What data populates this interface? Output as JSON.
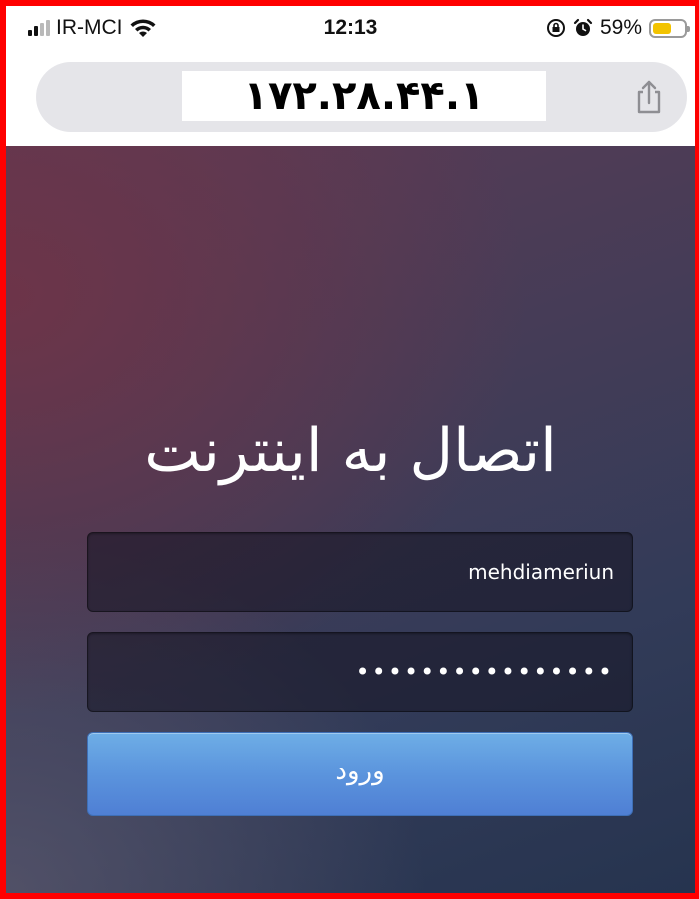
{
  "status_bar": {
    "carrier": "IR-MCI",
    "time": "12:13",
    "battery_percent": "59%",
    "battery_level": 0.59,
    "icons": [
      "signal-icon",
      "wifi-icon",
      "rotation-lock-icon",
      "alarm-icon",
      "battery-icon"
    ]
  },
  "browser": {
    "url": "۱۷۲.۲۸.۴۴.۱",
    "share_icon": "share-icon"
  },
  "login": {
    "title": "اتصال به اینترنت",
    "username_value": "mehdiameriun",
    "password_value": "••••••••••••••••",
    "submit_label": "ورود"
  },
  "colors": {
    "button_blue": "#5b94dd",
    "battery_yellow": "#f2c300",
    "frame_red": "#ff0000"
  }
}
